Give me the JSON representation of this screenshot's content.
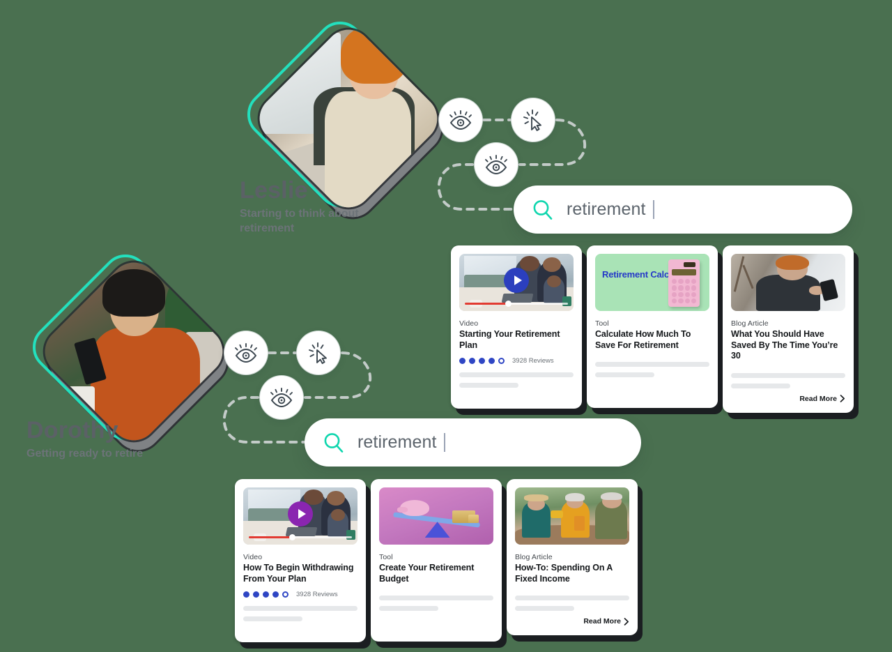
{
  "personas": [
    {
      "name": "Leslie",
      "subtitle": "Starting to think about retirement",
      "portrait": "woman-with-tablet-in-shop",
      "accent_color": "#23e0bd"
    },
    {
      "name": "Dorothy",
      "subtitle": "Getting ready to retire",
      "portrait": "woman-with-phone-at-cafe",
      "accent_color": "#23e0bd"
    }
  ],
  "journey_icons": [
    {
      "name": "eye-icon",
      "label": "View"
    },
    {
      "name": "click-cursor-icon",
      "label": "Click"
    },
    {
      "name": "eye-icon",
      "label": "View"
    }
  ],
  "searches": [
    {
      "query": "retirement",
      "placeholder": "Search",
      "icon": "search-icon"
    },
    {
      "query": "retirement",
      "placeholder": "Search",
      "icon": "search-icon"
    }
  ],
  "result_rows": [
    {
      "persona": "Leslie",
      "cards": [
        {
          "kind": "Video",
          "title": "Starting Your Retirement Plan",
          "thumb": "family-on-couch-with-laptop",
          "play_color": "#2b3fbe",
          "rating_filled": 4,
          "rating_total": 5,
          "reviews": "3928 Reviews",
          "has_read_more": false,
          "read_more_label": "Read More"
        },
        {
          "kind": "Tool",
          "title": "Calculate How Much To Save For Retirement",
          "thumb": "retirement-calculator-tile",
          "tile_text": "Retirement Calculator",
          "tile_bg": "#a9e3b6",
          "tile_text_color": "#2538c8",
          "has_read_more": false,
          "read_more_label": "Read More"
        },
        {
          "kind": "Blog Article",
          "title": "What You Should Have Saved By The Time You’re 30",
          "thumb": "woman-reading-phone-by-window",
          "has_read_more": true,
          "read_more_label": "Read More"
        }
      ]
    },
    {
      "persona": "Dorothy",
      "cards": [
        {
          "kind": "Video",
          "title": "How To Begin Withdrawing From Your Plan",
          "thumb": "family-on-couch-with-laptop",
          "play_color": "#8a25b0",
          "rating_filled": 4,
          "rating_total": 5,
          "reviews": "3928 Reviews",
          "has_read_more": false,
          "read_more_label": "Read More"
        },
        {
          "kind": "Tool",
          "title": "Create Your Retirement Budget",
          "thumb": "piggy-bank-seesaw-tile",
          "tile_bg": "#c378bf",
          "has_read_more": false,
          "read_more_label": "Read More"
        },
        {
          "kind": "Blog Article",
          "title": "How-To: Spending On A Fixed Income",
          "thumb": "friends-toasting-outdoors",
          "has_read_more": true,
          "read_more_label": "Read More"
        }
      ]
    }
  ],
  "colors": {
    "background": "#4a7050",
    "teal_accent": "#23e0bd",
    "search_icon": "#0fd6ae",
    "rating_blue": "#2f46c4",
    "card_shadow": "#1b1e21",
    "path_dash": "#c8cfcd"
  }
}
